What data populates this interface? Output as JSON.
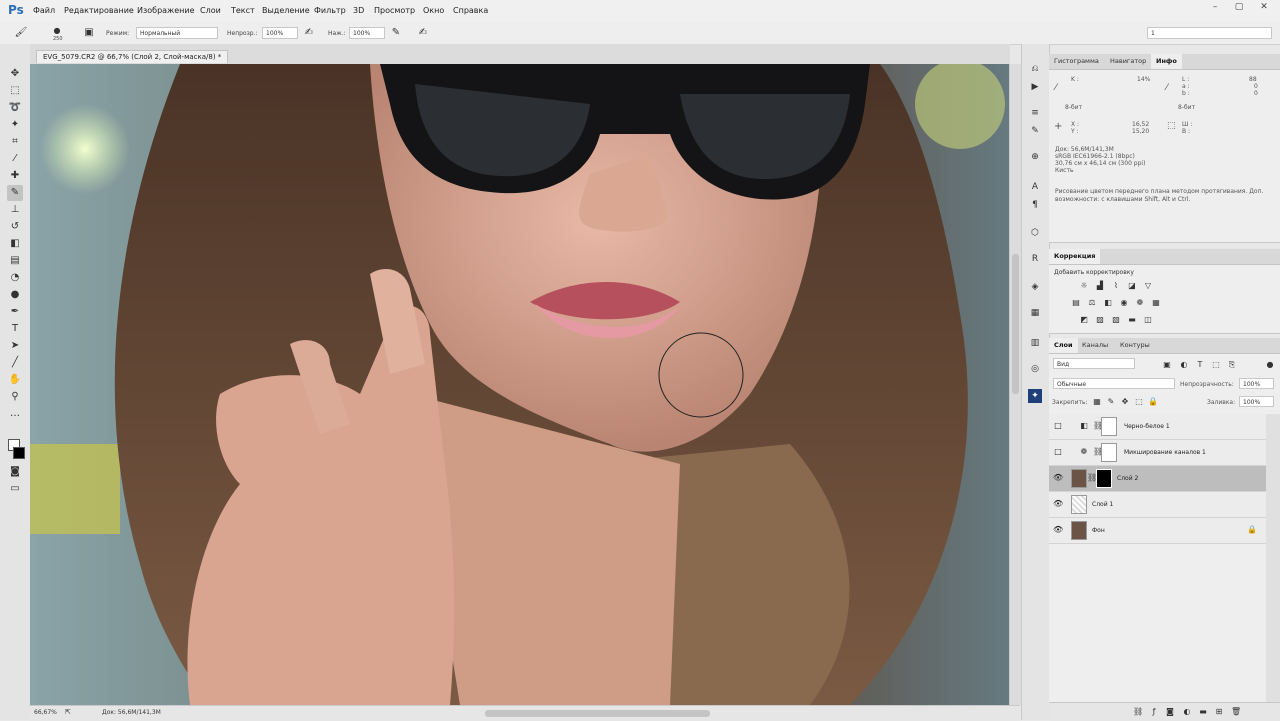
{
  "app": {
    "logo": "Ps"
  },
  "menu": [
    "Файл",
    "Редактирование",
    "Изображение",
    "Слои",
    "Текст",
    "Выделение",
    "Фильтр",
    "3D",
    "Просмотр",
    "Окно",
    "Справка"
  ],
  "options": {
    "brush_size": "250",
    "mode_label": "Режим:",
    "mode_value": "Нормальный",
    "opacity_label": "Непрозр.:",
    "opacity_value": "100%",
    "pressure_label": "Наж.:",
    "pressure_value": "100%",
    "workspace_value": "1"
  },
  "document": {
    "tab_title": "EVG_5079.CR2 @ 66,7% (Слой 2, Слой-маска/8) *",
    "zoom": "66,67%",
    "doc_info": "Док: 56,6M/141,3M"
  },
  "info_panel": {
    "tabs": [
      "Гистограмма",
      "Навигатор",
      "Инфо"
    ],
    "k_label": "K :",
    "k_value": "14%",
    "l_label": "L :",
    "l_value": "88",
    "a_label": "a :",
    "a_value": "0",
    "b_label": "b :",
    "b_value": "0",
    "bit_left": "8-бит",
    "bit_right": "8-бит",
    "x_label": "X :",
    "x_value": "16,52",
    "y_label": "Y :",
    "y_value": "15,20",
    "w_label": "Ш :",
    "h_label": "В :",
    "doc_line": "Док: 56,6M/141,3M",
    "profile_line": "sRGB IEC61966-2.1 (8bpc)",
    "size_line": "30,76 см x 46,14 см (300 ppi)",
    "tool_line": "Кисть",
    "hint": "Рисование цветом переднего плана методом протягивания. Доп. возможности: с клавишами Shift, Alt и Ctrl."
  },
  "corrections_panel": {
    "tab": "Коррекция",
    "add_label": "Добавить корректировку"
  },
  "layers_panel": {
    "tabs": [
      "Слои",
      "Каналы",
      "Контуры"
    ],
    "filter_value": "Вид",
    "blend_value": "Обычные",
    "opacity_label": "Непрозрачность:",
    "opacity_value": "100%",
    "lock_label": "Закрепить:",
    "fill_label": "Заливка:",
    "fill_value": "100%",
    "layers": [
      {
        "name": "Черно-белое 1",
        "visible": false
      },
      {
        "name": "Микширование каналов 1",
        "visible": false
      },
      {
        "name": "Слой 2",
        "visible": true
      },
      {
        "name": "Слой 1",
        "visible": true
      },
      {
        "name": "Фон",
        "visible": true
      }
    ]
  }
}
